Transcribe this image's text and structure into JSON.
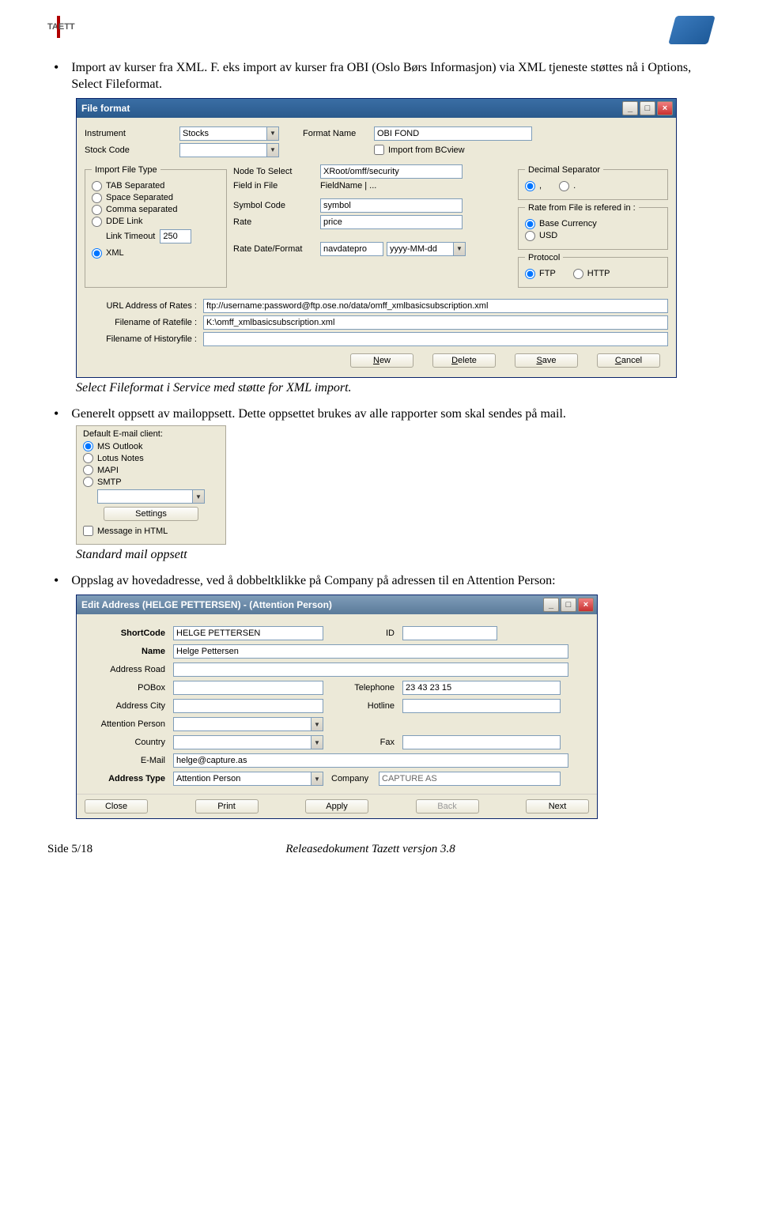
{
  "header": {
    "left_logo_text": "TAZETT"
  },
  "para1": "Import av kurser fra XML. F. eks import av kurser fra OBI (Oslo Børs Informasjon) via XML tjeneste støttes nå i Options, Select Fileformat.",
  "caption1": "Select Fileformat i Service med støtte for XML import.",
  "para2": "Generelt oppsett av mailoppsett. Dette oppsettet brukes av alle rapporter som skal sendes på mail.",
  "caption2": "Standard mail oppsett",
  "para3": "Oppslag av hovedadresse, ved å dobbeltklikke på Company på adressen til en Attention Person:",
  "footer": {
    "left": "Side 5/18",
    "center": "Releasedokument Tazett versjon 3.8"
  },
  "fileformat": {
    "title": "File format",
    "instrument_label": "Instrument",
    "instrument_value": "Stocks",
    "stockcode_label": "Stock Code",
    "stockcode_value": "",
    "formatname_label": "Format Name",
    "formatname_value": "OBI FOND",
    "import_bcview": "Import from BCview",
    "import_file_type": {
      "legend": "Import File Type",
      "tab": "TAB Separated",
      "space": "Space Separated",
      "comma": "Comma separated",
      "dde": "DDE Link",
      "link_timeout_label": "Link Timeout",
      "link_timeout_value": "250",
      "xml": "XML"
    },
    "fields": {
      "node_label": "Node To Select",
      "node_value": "XRoot/omff/security",
      "fieldinfile_label": "Field in File",
      "fieldinfile_value": "FieldName | ...",
      "symbol_label": "Symbol Code",
      "symbol_value": "symbol",
      "rate_label": "Rate",
      "rate_value": "price",
      "ratedate_label": "Rate Date/Format",
      "ratedate_val1": "navdatepro",
      "ratedate_val2": "yyyy-MM-dd"
    },
    "decimal": {
      "legend": "Decimal Separator",
      "comma": ",",
      "dot": "."
    },
    "ratefrom": {
      "legend": "Rate from File is refered in :",
      "base": "Base Currency",
      "usd": "USD"
    },
    "protocol": {
      "legend": "Protocol",
      "ftp": "FTP",
      "http": "HTTP"
    },
    "url_label": "URL Address of Rates :",
    "url_value": "ftp://username:password@ftp.ose.no/data/omff_xmlbasicsubscription.xml",
    "filename_label": "Filename of Ratefile :",
    "filename_value": "K:\\omff_xmlbasicsubscription.xml",
    "history_label": "Filename of Historyfile :",
    "history_value": "",
    "buttons": {
      "new": "New",
      "delete": "Delete",
      "save": "Save",
      "cancel": "Cancel"
    }
  },
  "email": {
    "legend": "Default E-mail client:",
    "outlook": "MS Outlook",
    "lotus": "Lotus Notes",
    "mapi": "MAPI",
    "smtp": "SMTP",
    "smtp_value": "",
    "settings": "Settings",
    "message_html": "Message in HTML"
  },
  "address": {
    "title": "Edit Address (HELGE PETTERSEN) -  (Attention Person)",
    "shortcode_label": "ShortCode",
    "shortcode_value": "HELGE PETTERSEN",
    "id_label": "ID",
    "id_value": "",
    "name_label": "Name",
    "name_value": "Helge Pettersen",
    "road_label": "Address Road",
    "road_value": "",
    "pobox_label": "POBox",
    "pobox_value": "",
    "telephone_label": "Telephone",
    "telephone_value": "23 43 23 15",
    "city_label": "Address City",
    "city_value": "",
    "hotline_label": "Hotline",
    "hotline_value": "",
    "attn_label": "Attention Person",
    "attn_value": "",
    "country_label": "Country",
    "country_value": "",
    "fax_label": "Fax",
    "fax_value": "",
    "email_label": "E-Mail",
    "email_value": "helge@capture.as",
    "addrtype_label": "Address Type",
    "addrtype_value": "Attention Person",
    "company_label": "Company",
    "company_value": "CAPTURE AS",
    "buttons": {
      "close": "Close",
      "print": "Print",
      "apply": "Apply",
      "back": "Back",
      "next": "Next"
    }
  }
}
